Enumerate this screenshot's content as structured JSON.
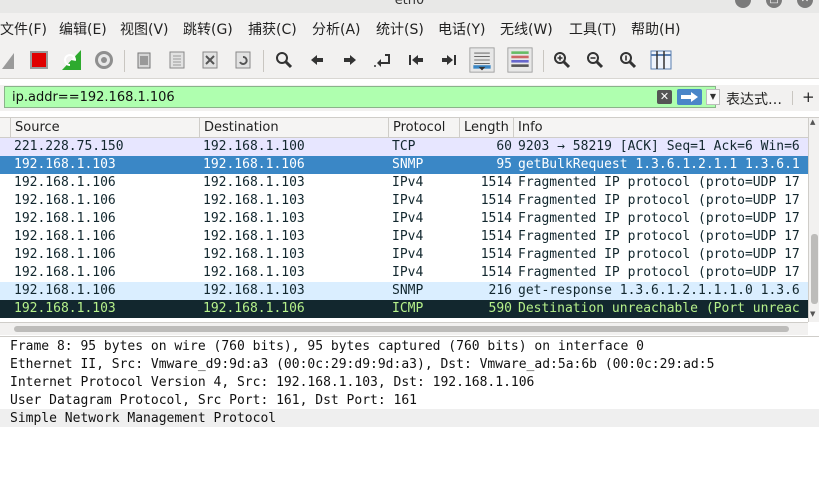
{
  "window": {
    "title": "eth0"
  },
  "menubar": {
    "items": [
      "文件(F)",
      "编辑(E)",
      "视图(V)",
      "跳转(G)",
      "捕获(C)",
      "分析(A)",
      "统计(S)",
      "电话(Y)",
      "无线(W)",
      "工具(T)",
      "帮助(H)"
    ]
  },
  "toolbar": {
    "icons": [
      "start-capture-icon",
      "stop-capture-icon",
      "restart-capture-icon",
      "capture-options-icon",
      "open-file-icon",
      "save-file-icon",
      "close-file-icon",
      "reload-file-icon",
      "find-packet-icon",
      "go-back-icon",
      "go-forward-icon",
      "go-to-packet-icon",
      "go-first-icon",
      "go-last-icon",
      "auto-scroll-icon",
      "colorize-icon",
      "zoom-in-icon",
      "zoom-out-icon",
      "zoom-normal-icon",
      "resize-columns-icon"
    ]
  },
  "filter": {
    "value": "ip.addr==192.168.1.106",
    "clear_symbol": "✕",
    "dropdown_symbol": "▼",
    "expression_label": "表达式…",
    "add_label": "+"
  },
  "packet_list": {
    "columns": [
      "Source",
      "Destination",
      "Protocol",
      "Length",
      "Info"
    ],
    "rows": [
      {
        "source": "221.228.75.150",
        "destination": "192.168.1.100",
        "protocol": "TCP",
        "length": "60",
        "info": "9203 → 58219 [ACK] Seq=1 Ack=6 Win=6",
        "bg": "#e7e6ff",
        "fg": "#12272e"
      },
      {
        "source": "192.168.1.103",
        "destination": "192.168.1.106",
        "protocol": "SNMP",
        "length": "95",
        "info": "getBulkRequest 1.3.6.1.2.1.1 1.3.6.1",
        "bg": "#3a87c6",
        "fg": "#ffffff",
        "selected": true
      },
      {
        "source": "192.168.1.106",
        "destination": "192.168.1.103",
        "protocol": "IPv4",
        "length": "1514",
        "info": "Fragmented IP protocol (proto=UDP 17",
        "bg": "#ffffff",
        "fg": "#12272e"
      },
      {
        "source": "192.168.1.106",
        "destination": "192.168.1.103",
        "protocol": "IPv4",
        "length": "1514",
        "info": "Fragmented IP protocol (proto=UDP 17",
        "bg": "#ffffff",
        "fg": "#12272e"
      },
      {
        "source": "192.168.1.106",
        "destination": "192.168.1.103",
        "protocol": "IPv4",
        "length": "1514",
        "info": "Fragmented IP protocol (proto=UDP 17",
        "bg": "#ffffff",
        "fg": "#12272e"
      },
      {
        "source": "192.168.1.106",
        "destination": "192.168.1.103",
        "protocol": "IPv4",
        "length": "1514",
        "info": "Fragmented IP protocol (proto=UDP 17",
        "bg": "#ffffff",
        "fg": "#12272e"
      },
      {
        "source": "192.168.1.106",
        "destination": "192.168.1.103",
        "protocol": "IPv4",
        "length": "1514",
        "info": "Fragmented IP protocol (proto=UDP 17",
        "bg": "#ffffff",
        "fg": "#12272e"
      },
      {
        "source": "192.168.1.106",
        "destination": "192.168.1.103",
        "protocol": "IPv4",
        "length": "1514",
        "info": "Fragmented IP protocol (proto=UDP 17",
        "bg": "#ffffff",
        "fg": "#12272e"
      },
      {
        "source": "192.168.1.106",
        "destination": "192.168.1.103",
        "protocol": "SNMP",
        "length": "216",
        "info": "get-response 1.3.6.1.2.1.1.1.0 1.3.6",
        "bg": "#daeeff",
        "fg": "#12272e"
      },
      {
        "source": "192.168.1.103",
        "destination": "192.168.1.106",
        "protocol": "ICMP",
        "length": "590",
        "info": "Destination unreachable (Port unreac",
        "bg": "#12272e",
        "fg": "#b5f08a"
      }
    ]
  },
  "packet_details": {
    "lines": [
      "Frame 8: 95 bytes on wire (760 bits), 95 bytes captured (760 bits) on interface 0",
      "Ethernet II, Src: Vmware_d9:9d:a3 (00:0c:29:d9:9d:a3), Dst: Vmware_ad:5a:6b (00:0c:29:ad:5",
      "Internet Protocol Version 4, Src: 192.168.1.103, Dst: 192.168.1.106",
      "User Datagram Protocol, Src Port: 161, Dst Port: 161",
      "Simple Network Management Protocol"
    ]
  },
  "colors": {
    "filter_valid_bg": "#afffaf",
    "selected_row_bg": "#3a87c6",
    "stop_button": "#e00000",
    "restart_button": "#2eaa2e"
  }
}
